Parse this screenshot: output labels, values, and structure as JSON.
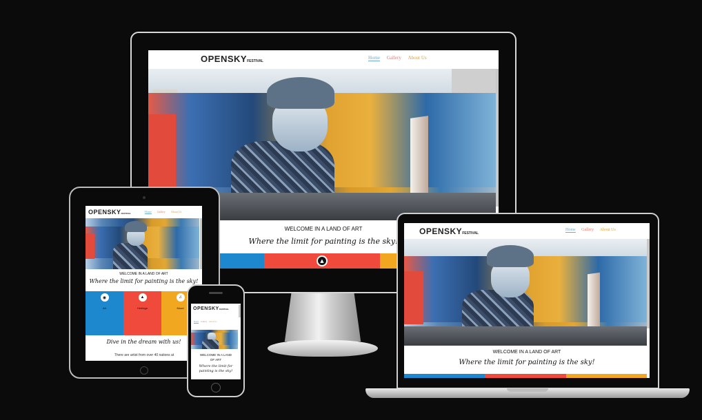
{
  "site": {
    "logo_main": "OPENSKY",
    "logo_sub": "FESTIVAL",
    "nav": {
      "home": "Home",
      "gallery": "Gallery",
      "about": "About Us"
    },
    "welcome": "WELCOME IN A LAND OF ART",
    "tagline": "Where the limit for painting is the sky!",
    "columns": [
      {
        "title": "Art",
        "icon": "palette-icon",
        "color": "#1e88cf"
      },
      {
        "title": "Heritage",
        "icon": "building-icon",
        "color": "#ef4a3c"
      },
      {
        "title": "Mood",
        "icon": "music-icon",
        "color": "#f1a820"
      }
    ],
    "dive": "Dive in the dream with us!",
    "artists": "There are artist from over 40 nations at"
  },
  "colors": {
    "blue": "#1e88cf",
    "red": "#ef4a3c",
    "yellow": "#f1a820",
    "background": "#0c0b0b"
  }
}
